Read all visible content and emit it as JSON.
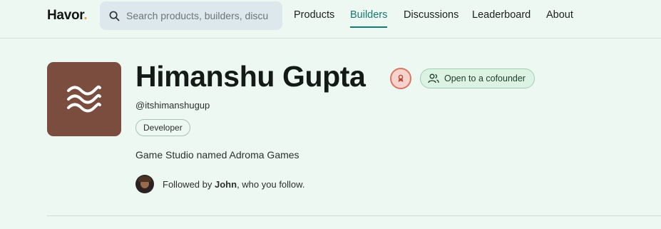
{
  "header": {
    "logo_text": "Havor",
    "logo_dot": ".",
    "search_placeholder": "Search products, builders, discu",
    "nav": [
      {
        "label": "Products",
        "active": false
      },
      {
        "label": "Builders",
        "active": true
      },
      {
        "label": "Discussions",
        "active": false
      },
      {
        "label": "Leaderboard",
        "active": false
      },
      {
        "label": "About",
        "active": false
      }
    ]
  },
  "profile": {
    "name": "Himanshu Gupta",
    "handle": "@itshimanshugup",
    "role": "Developer",
    "cofounder_label": "Open to a cofounder",
    "bio": "Game Studio named Adroma Games",
    "followed_prefix": "Followed by ",
    "followed_name": "John",
    "followed_suffix": ", who you follow."
  },
  "colors": {
    "background": "#eef8f2",
    "accent": "#147a70",
    "avatar_bg": "#7a4d3f",
    "logo_dot": "#e0a23a"
  },
  "icons": {
    "search": "search-icon",
    "avatar": "waves-icon",
    "award": "award-badge-icon",
    "cofounder": "users-icon"
  }
}
